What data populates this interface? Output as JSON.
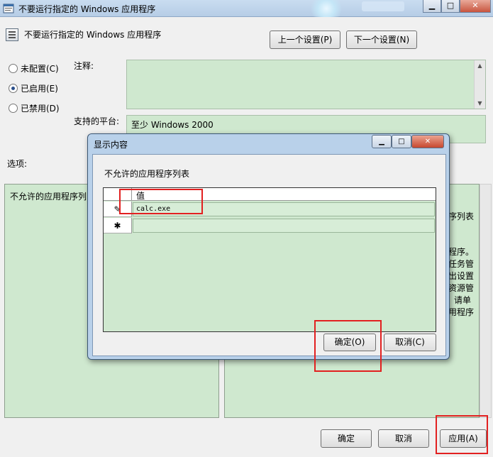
{
  "window": {
    "title": "不要运行指定的 Windows 应用程序",
    "controls": {
      "minimize": "▁",
      "maximize": "□",
      "close": "✕"
    }
  },
  "policy": {
    "title": "不要运行指定的 Windows 应用程序",
    "prev_button": "上一个设置(P)",
    "next_button": "下一个设置(N)",
    "radio": [
      {
        "label": "未配置(C)",
        "checked": false
      },
      {
        "label": "已启用(E)",
        "checked": true
      },
      {
        "label": "已禁用(D)",
        "checked": false
      }
    ],
    "comment_label": "注释:",
    "platform_label": "支持的平台:",
    "platform_value": "至少 Windows 2000",
    "options_label": "选项:",
    "options_item": "不允许的应用程序列"
  },
  "help_fragments": [
    "序列表",
    "程序。",
    "任务管",
    "出设置",
    "资源管",
    "请单",
    "用程序"
  ],
  "footer": {
    "ok": "确定",
    "cancel": "取消",
    "apply": "应用(A)"
  },
  "dialog": {
    "title": "显示内容",
    "controls": {
      "minimize": "▁",
      "maximize": "□",
      "close": "✕"
    },
    "list_label": "不允许的应用程序列表",
    "column_header": "值",
    "rows": [
      {
        "marker": "✎",
        "value": "calc.exe"
      },
      {
        "marker": "✱",
        "value": ""
      }
    ],
    "ok": "确定(O)",
    "cancel": "取消(C)"
  },
  "colors": {
    "content_green": "#cfe8cf",
    "highlight_red": "#e22020",
    "dialog_frame": "#b9d1ea"
  }
}
